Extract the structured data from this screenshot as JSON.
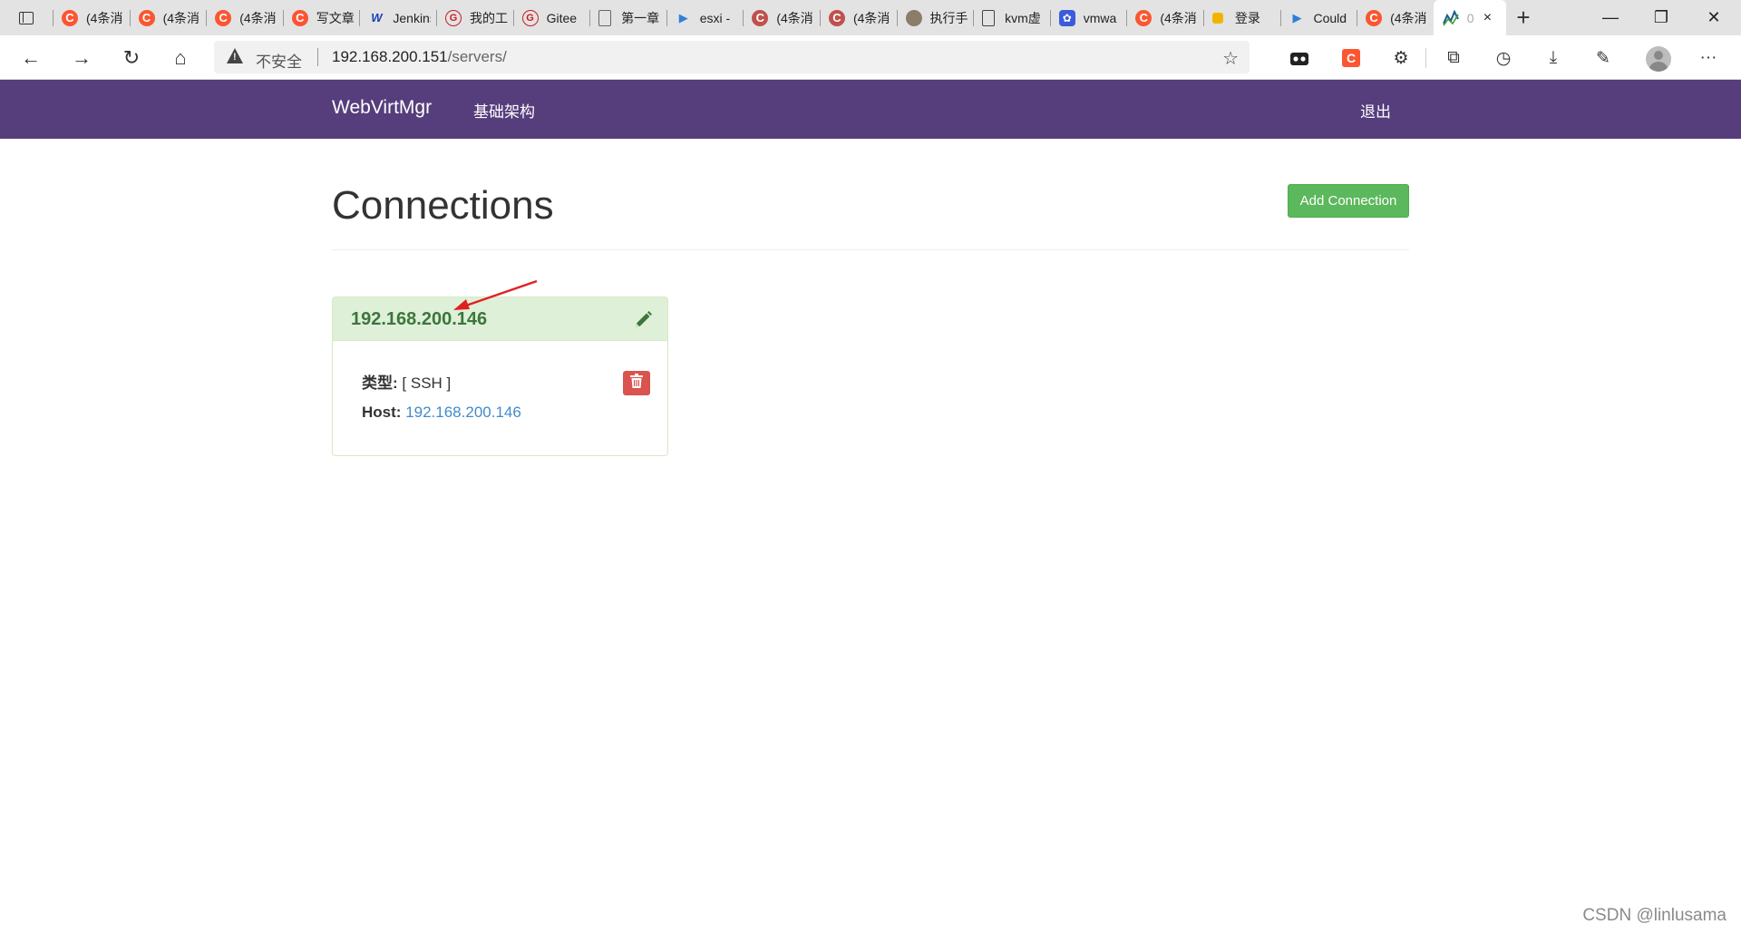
{
  "browser": {
    "tabs": [
      {
        "label": "(4条消",
        "favicon": "csdn",
        "color": "#fc5531"
      },
      {
        "label": "(4条消",
        "favicon": "csdn",
        "color": "#fc5531"
      },
      {
        "label": "(4条消",
        "favicon": "csdn",
        "color": "#fc5531"
      },
      {
        "label": "写文章",
        "favicon": "csdn",
        "color": "#fc5531"
      },
      {
        "label": "Jenkins",
        "favicon": "w",
        "color": "#1a3fb5"
      },
      {
        "label": "我的工",
        "favicon": "gitee",
        "color": "#c71d23"
      },
      {
        "label": "Gitee",
        "favicon": "gitee",
        "color": "#c71d23"
      },
      {
        "label": "第一章",
        "favicon": "page",
        "color": "#666666"
      },
      {
        "label": "esxi -",
        "favicon": "bing",
        "color": "#2f7fd8"
      },
      {
        "label": "(4条消",
        "favicon": "csdn",
        "color": "#c0504d"
      },
      {
        "label": "(4条消",
        "favicon": "csdn",
        "color": "#c0504d"
      },
      {
        "label": "执行手",
        "favicon": "avatar",
        "color": "#8b7d6b"
      },
      {
        "label": "kvm虚",
        "favicon": "page",
        "color": "#444444"
      },
      {
        "label": "vmwa",
        "favicon": "baidu",
        "color": "#3b5bdb"
      },
      {
        "label": "(4条消",
        "favicon": "csdn",
        "color": "#fc5531"
      },
      {
        "label": "登录",
        "favicon": "yellow",
        "color": "#f0b400"
      },
      {
        "label": "Could",
        "favicon": "bing",
        "color": "#2f7fd8"
      },
      {
        "label": "(4条消",
        "favicon": "csdn",
        "color": "#fc5531"
      }
    ],
    "active_tab": {
      "label": "0",
      "close": "×"
    },
    "new_tab": "+",
    "address": {
      "security_label": "不安全",
      "host": "192.168.200.151",
      "path": "/servers/"
    },
    "window_controls": {
      "minimize": "—",
      "restore": "❐",
      "close": "✕"
    }
  },
  "navbar": {
    "brand": "WebVirtMgr",
    "infrastructure": "基础架构",
    "logout": "退出",
    "color": "#563d7c"
  },
  "page": {
    "title": "Connections",
    "add_button": "Add Connection"
  },
  "connection": {
    "name": "192.168.200.146",
    "type_label": "类型:",
    "type_value": "[ SSH ]",
    "host_label": "Host:",
    "host_value": "192.168.200.146"
  },
  "watermark": "CSDN @linlusama"
}
